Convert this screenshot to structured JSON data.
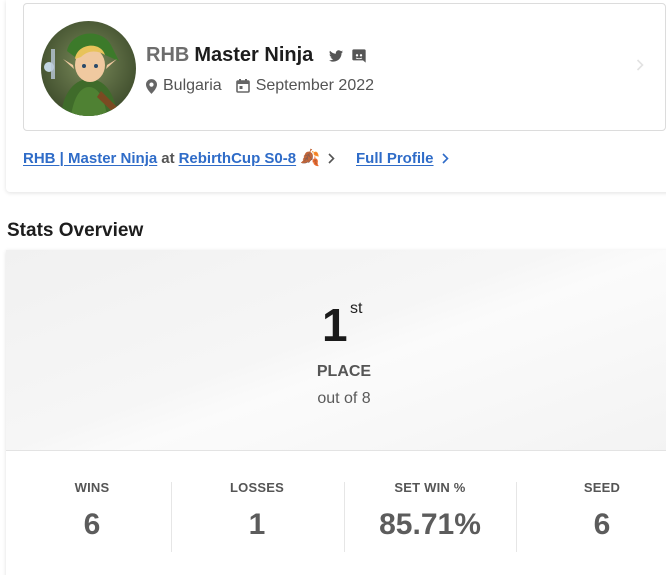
{
  "profile": {
    "prefix": "RHB",
    "gamertag": "Master Ninja",
    "location": "Bulgaria",
    "joined": "September 2022",
    "social_icons": [
      "twitter-icon",
      "discord-icon"
    ]
  },
  "links": {
    "event_player": "RHB | Master Ninja",
    "at": "at",
    "event_name": "RebirthCup S0-8",
    "event_emoji": "🍂",
    "full_profile": "Full Profile"
  },
  "stats_overview": {
    "title": "Stats Overview",
    "placement": "1",
    "placement_suffix": "st",
    "placement_label": "PLACE",
    "out_of": "out of 8",
    "items": [
      {
        "label": "WINS",
        "value": "6"
      },
      {
        "label": "LOSSES",
        "value": "1"
      },
      {
        "label": "SET WIN %",
        "value": "85.71%"
      },
      {
        "label": "SEED",
        "value": "6"
      }
    ]
  },
  "colors": {
    "link": "#2f6cc8",
    "text": "#1d1d1d",
    "muted": "#555555"
  }
}
